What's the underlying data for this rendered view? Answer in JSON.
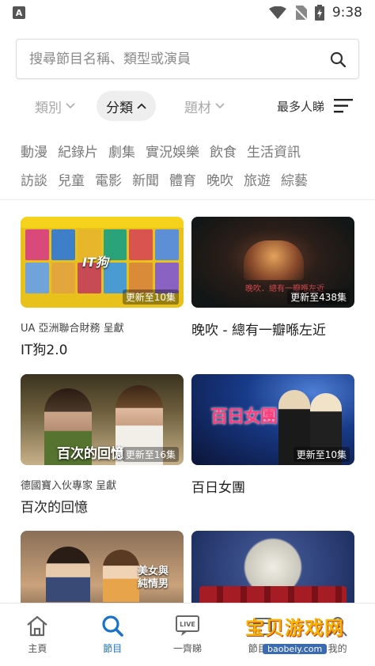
{
  "status_bar": {
    "time": "9:38"
  },
  "search": {
    "placeholder": "搜尋節目名稱、類型或演員"
  },
  "filters": [
    {
      "label": "類別",
      "active": false
    },
    {
      "label": "分類",
      "active": true
    },
    {
      "label": "題材",
      "active": false
    }
  ],
  "sort": {
    "label": "最多人睇"
  },
  "tags": {
    "row1": [
      "動漫",
      "紀錄片",
      "劇集",
      "實況娛樂",
      "飲食",
      "生活資訊"
    ],
    "row2": [
      "訪談",
      "兒童",
      "電影",
      "新聞",
      "體育",
      "晚吹",
      "旅遊",
      "綜藝"
    ]
  },
  "programs": [
    {
      "sponsor": "UA 亞洲聯合財務 呈獻",
      "title": "IT狗2.0",
      "episode_badge": "更新至10集",
      "thumb_logo": "IT狗"
    },
    {
      "sponsor": "",
      "title": "晚吹 - 總有一瓣喺左近",
      "episode_badge": "更新至438集",
      "thumb_text": "晚吹．總有一瓣喺左近"
    },
    {
      "sponsor": "德國寶入伙專家 呈獻",
      "title": "百次的回憶",
      "episode_badge": "更新至16集",
      "thumb_text": "百次的回憶"
    },
    {
      "sponsor": "",
      "title": "百日女團",
      "episode_badge": "更新至10集",
      "thumb_logo": "百日女團"
    },
    {
      "thumb_text": "美女與\n純情男"
    },
    {}
  ],
  "bottom_nav": [
    {
      "label": "主頁",
      "icon": "home-icon",
      "active": false
    },
    {
      "label": "節目",
      "icon": "search-icon",
      "active": true
    },
    {
      "label": "一齊睇",
      "icon": "live-icon",
      "active": false
    },
    {
      "label": "節目表",
      "icon": "schedule-icon",
      "active": false
    },
    {
      "label": "我的",
      "icon": "profile-icon",
      "active": false
    }
  ],
  "watermark": {
    "text": "宝贝游戏网",
    "url": "baobeiy.com"
  },
  "colors": {
    "accent": "#1a73c8",
    "tag_text": "#7a7a7a",
    "inactive_filter": "#a8a8a8"
  }
}
